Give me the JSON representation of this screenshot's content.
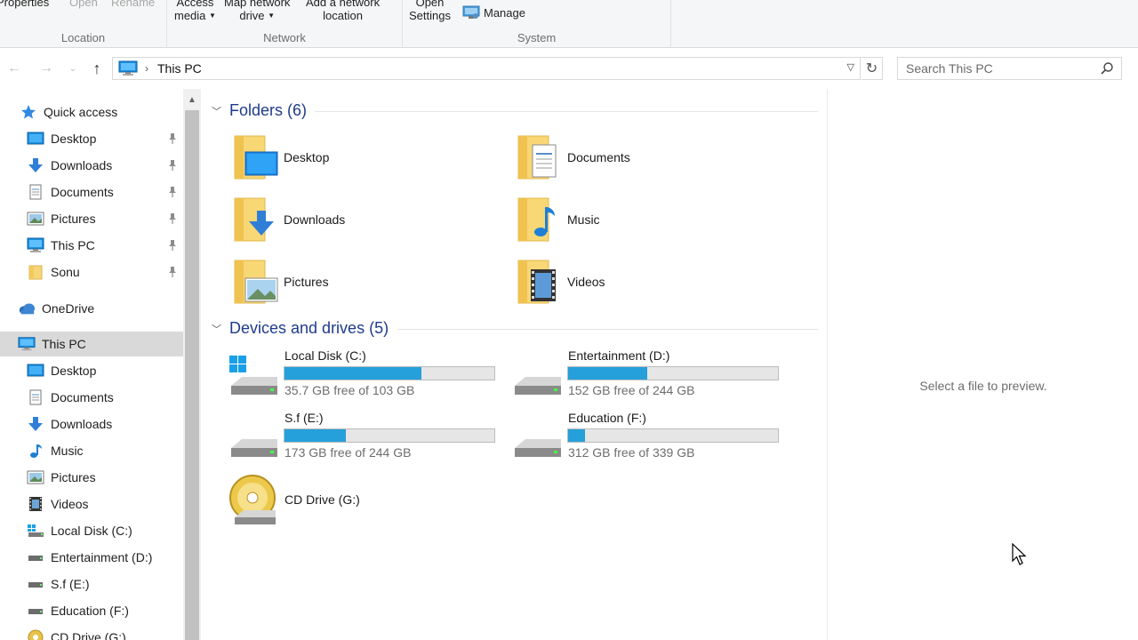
{
  "ribbon": {
    "location": {
      "properties": "Properties",
      "open": "Open",
      "rename": "Rename",
      "label": "Location"
    },
    "network": {
      "access_media_l1": "Access",
      "access_media_l2": "media",
      "map_drive_l1": "Map network",
      "map_drive_l2": "drive",
      "add_location_l1": "Add a network",
      "add_location_l2": "location",
      "label": "Network"
    },
    "system": {
      "open_settings_l1": "Open",
      "open_settings_l2": "Settings",
      "manage": "Manage",
      "label": "System"
    }
  },
  "address": {
    "path": "This PC",
    "search_placeholder": "Search This PC"
  },
  "sidebar": {
    "quick_access": "Quick access",
    "quick_items": [
      "Desktop",
      "Downloads",
      "Documents",
      "Pictures",
      "This PC",
      "Sonu"
    ],
    "onedrive": "OneDrive",
    "this_pc": "This PC",
    "pc_items": [
      "Desktop",
      "Documents",
      "Downloads",
      "Music",
      "Pictures",
      "Videos",
      "Local Disk (C:)",
      "Entertainment (D:)",
      "S.f (E:)",
      "Education (F:)",
      "CD Drive (G:)"
    ]
  },
  "main": {
    "folders_header": "Folders (6)",
    "folders": [
      "Desktop",
      "Documents",
      "Downloads",
      "Music",
      "Pictures",
      "Videos"
    ],
    "drives_header": "Devices and drives (5)",
    "drives": [
      {
        "name": "Local Disk (C:)",
        "free": "35.7 GB free of 103 GB",
        "used_fraction": 0.653
      },
      {
        "name": "Entertainment (D:)",
        "free": "152 GB free of 244 GB",
        "used_fraction": 0.377
      },
      {
        "name": "S.f (E:)",
        "free": "173 GB free of 244 GB",
        "used_fraction": 0.291
      },
      {
        "name": "Education (F:)",
        "free": "312 GB free of 339 GB",
        "used_fraction": 0.08
      }
    ],
    "cd_drive": "CD Drive (G:)"
  },
  "preview": {
    "message": "Select a file to preview."
  },
  "colors": {
    "accent": "#26a0da",
    "section_header": "#1e3c8c",
    "selected_bg": "#d9d9d9"
  }
}
